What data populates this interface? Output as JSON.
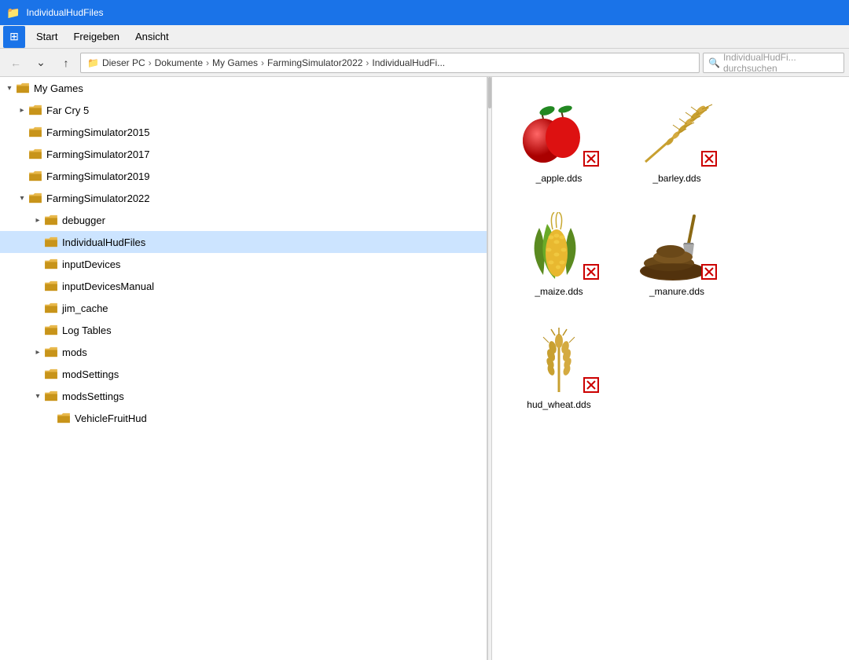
{
  "titlebar": {
    "label": "IndividualHudFiles"
  },
  "menubar": {
    "items": [
      "Start",
      "Freigeben",
      "Ansicht"
    ]
  },
  "navbar": {
    "back_label": "←",
    "up_label": "↑",
    "dropdown_label": "⌄",
    "address": {
      "parts": [
        "Dieser PC",
        "Dokumente",
        "My Games",
        "FarmingSimulator2022",
        "IndividualHudFi..."
      ]
    },
    "search_placeholder": "IndividualHudFi... durchsuchen"
  },
  "tree": {
    "items": [
      {
        "id": "my-games",
        "label": "My Games",
        "indent": 0,
        "state": "open",
        "selected": false
      },
      {
        "id": "far-cry-5",
        "label": "Far Cry 5",
        "indent": 1,
        "state": "closed",
        "selected": false
      },
      {
        "id": "farming-2015",
        "label": "FarmingSimulator2015",
        "indent": 1,
        "state": "none",
        "selected": false
      },
      {
        "id": "farming-2017",
        "label": "FarmingSimulator2017",
        "indent": 1,
        "state": "none",
        "selected": false
      },
      {
        "id": "farming-2019",
        "label": "FarmingSimulator2019",
        "indent": 1,
        "state": "none",
        "selected": false
      },
      {
        "id": "farming-2022",
        "label": "FarmingSimulator2022",
        "indent": 1,
        "state": "open",
        "selected": false
      },
      {
        "id": "debugger",
        "label": "debugger",
        "indent": 2,
        "state": "closed",
        "selected": false
      },
      {
        "id": "individual-hud",
        "label": "IndividualHudFiles",
        "indent": 2,
        "state": "none",
        "selected": true
      },
      {
        "id": "input-devices",
        "label": "inputDevices",
        "indent": 2,
        "state": "none",
        "selected": false
      },
      {
        "id": "input-devices-manual",
        "label": "inputDevicesManual",
        "indent": 2,
        "state": "none",
        "selected": false
      },
      {
        "id": "jim-cache",
        "label": "jim_cache",
        "indent": 2,
        "state": "none",
        "selected": false
      },
      {
        "id": "log-tables",
        "label": "Log Tables",
        "indent": 2,
        "state": "none",
        "selected": false
      },
      {
        "id": "mods",
        "label": "mods",
        "indent": 2,
        "state": "closed",
        "selected": false
      },
      {
        "id": "mod-settings",
        "label": "modSettings",
        "indent": 2,
        "state": "none",
        "selected": false
      },
      {
        "id": "mods-settings",
        "label": "modsSettings",
        "indent": 2,
        "state": "open",
        "selected": false
      },
      {
        "id": "vehicle-fruit-hud",
        "label": "VehicleFruitHud",
        "indent": 3,
        "state": "none",
        "selected": false
      }
    ]
  },
  "files": [
    {
      "id": "apple",
      "name": "_apple.dds",
      "icon": "apple"
    },
    {
      "id": "barley",
      "name": "_barley.dds",
      "icon": "barley"
    },
    {
      "id": "maize",
      "name": "_maize.dds",
      "icon": "maize"
    },
    {
      "id": "manure",
      "name": "_manure.dds",
      "icon": "manure"
    },
    {
      "id": "wheat",
      "name": "hud_wheat.dds",
      "icon": "wheat"
    }
  ],
  "colors": {
    "accent": "#1a73e8",
    "selected_bg": "#cce4ff",
    "folder": "#e8b84b"
  }
}
